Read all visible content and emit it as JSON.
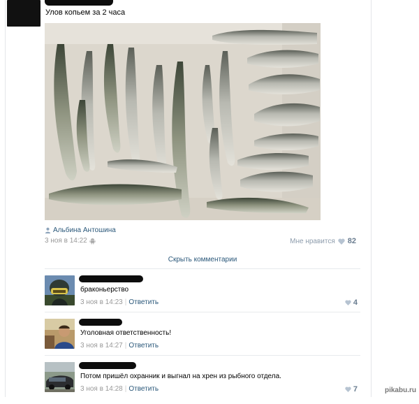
{
  "post": {
    "text": "Улов копьем за 2 часа",
    "photo_author": "Альбина Антошина",
    "date": "3 ноя в 14:22",
    "likes_label": "Мне нравится",
    "likes_count": "82"
  },
  "hide_comments": "Скрыть комментарии",
  "comments": [
    {
      "text": "браконьерство",
      "date": "3 ноя в 14:23",
      "reply": "Ответить",
      "likes": "4"
    },
    {
      "text": "Уголовная ответственность!",
      "date": "3 ноя в 14:27",
      "reply": "Ответить",
      "likes": ""
    },
    {
      "text": "Потом пришёл охранник и выгнал на хрен из рыбного отдела.",
      "date": "3 ноя в 14:28",
      "reply": "Ответить",
      "likes": "7"
    }
  ],
  "watermark": "pikabu.ru",
  "colors": {
    "link": "#2b587a",
    "meta": "#999999",
    "like": "#6a7d90",
    "separator": "#e7eaed"
  },
  "icons": [
    "person-icon",
    "android-icon",
    "heart-icon"
  ]
}
